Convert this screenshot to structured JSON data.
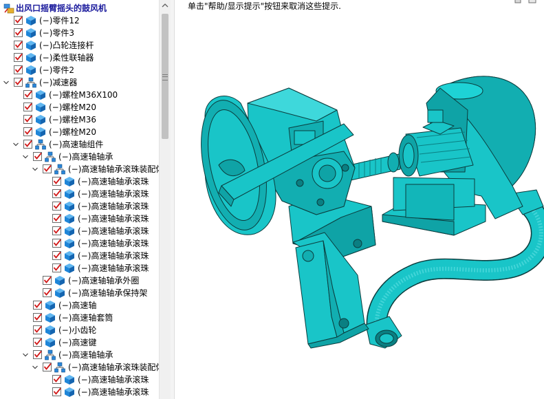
{
  "tree": {
    "root_label": "出风口摇臂摇头的鼓风机",
    "rows": [
      {
        "label": "(−)零件12",
        "type": "part"
      },
      {
        "label": "(−)零件3",
        "type": "part"
      },
      {
        "label": "(−)凸轮连接杆",
        "type": "part"
      },
      {
        "label": "(−)柔性联轴器",
        "type": "part"
      },
      {
        "label": "(−)零件2",
        "type": "part"
      },
      {
        "label": "(−)减速器",
        "type": "assembly"
      },
      {
        "label": "(−)螺栓M36X100",
        "type": "part"
      },
      {
        "label": "(−)螺栓M20",
        "type": "part"
      },
      {
        "label": "(−)螺栓M36",
        "type": "part"
      },
      {
        "label": "(−)螺栓M20",
        "type": "part"
      },
      {
        "label": "(−)高速轴组件",
        "type": "assembly"
      },
      {
        "label": "(−)高速轴轴承",
        "type": "assembly"
      },
      {
        "label": "(−)高速轴轴承滚珠装配体",
        "type": "assembly"
      },
      {
        "label": "(−)高速轴轴承滚珠",
        "type": "part"
      },
      {
        "label": "(−)高速轴轴承滚珠",
        "type": "part"
      },
      {
        "label": "(−)高速轴轴承滚珠",
        "type": "part"
      },
      {
        "label": "(−)高速轴轴承滚珠",
        "type": "part"
      },
      {
        "label": "(−)高速轴轴承滚珠",
        "type": "part"
      },
      {
        "label": "(−)高速轴轴承滚珠",
        "type": "part"
      },
      {
        "label": "(−)高速轴轴承滚珠",
        "type": "part"
      },
      {
        "label": "(−)高速轴轴承滚珠",
        "type": "part"
      },
      {
        "label": "(−)高速轴轴承外圈",
        "type": "part"
      },
      {
        "label": "(−)高速轴轴承保持架",
        "type": "part"
      },
      {
        "label": "(−)高速轴",
        "type": "part"
      },
      {
        "label": "(−)高速轴套筒",
        "type": "part"
      },
      {
        "label": "(−)小齿轮",
        "type": "part"
      },
      {
        "label": "(−)高速键",
        "type": "part"
      },
      {
        "label": "(−)高速轴轴承",
        "type": "assembly"
      },
      {
        "label": "(−)高速轴轴承滚珠装配体",
        "type": "assembly"
      },
      {
        "label": "(−)高速轴轴承滚珠",
        "type": "part"
      },
      {
        "label": "(−)高速轴轴承滚珠",
        "type": "part"
      }
    ]
  },
  "viewport": {
    "hint": "单击\"帮助/显示提示\"按钮来取消这些提示."
  },
  "colors": {
    "model": "#19c5c8",
    "model_dark": "#0a7f82",
    "model_edge": "#0b3c3d",
    "check": "#d01818",
    "part_icon": "#1f86d8",
    "root_text": "#1a1a9c"
  },
  "icons": {
    "root": "assembly-root-icon",
    "part": "part-cube-icon",
    "assembly": "subassembly-icon",
    "check": "checkbox-checked-icon",
    "expand": "chevron-down-icon"
  }
}
